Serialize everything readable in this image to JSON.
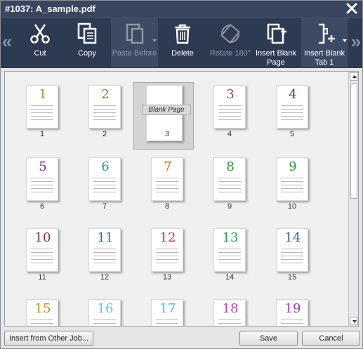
{
  "window": {
    "title": "#1037: A_sample.pdf"
  },
  "toolbar": {
    "cut": "Cut",
    "copy": "Copy",
    "paste_before": "Paste Before",
    "delete": "Delete",
    "rotate": "Rotate 180°",
    "insert_blank_page_1": "Insert Blank",
    "insert_blank_page_2": "Page",
    "insert_blank_tab_1": "Insert Blank",
    "insert_blank_tab_2": "Tab 1"
  },
  "pages": [
    {
      "n": "1",
      "label": "1",
      "color": "#9c8f3e"
    },
    {
      "n": "2",
      "label": "2",
      "color": "#8a7c40"
    },
    {
      "n": "",
      "label": "3",
      "blank": "Blank Page"
    },
    {
      "n": "3",
      "label": "4",
      "color": "#8b3a8f"
    },
    {
      "n": "4",
      "label": "5",
      "color": "#6a2f86"
    },
    {
      "n": "5",
      "label": "6",
      "color": "#6a2f86"
    },
    {
      "n": "6",
      "label": "7",
      "color": "#2f8bb5"
    },
    {
      "n": "7",
      "label": "8",
      "color": "#c2691e"
    },
    {
      "n": "8",
      "label": "9",
      "color": "#2e9a3b"
    },
    {
      "n": "9",
      "label": "10",
      "color": "#2e9a3b"
    },
    {
      "n": "10",
      "label": "11",
      "color": "#8c2e4e"
    },
    {
      "n": "11",
      "label": "12",
      "color": "#2f6fb5"
    },
    {
      "n": "12",
      "label": "13",
      "color": "#b5384e"
    },
    {
      "n": "13",
      "label": "14",
      "color": "#2e9a5b"
    },
    {
      "n": "14",
      "label": "15",
      "color": "#3a5f9c"
    },
    {
      "n": "15",
      "label": "",
      "color": "#c28a1e"
    },
    {
      "n": "16",
      "label": "",
      "color": "#55c8e0"
    },
    {
      "n": "17",
      "label": "",
      "color": "#44c0d0"
    },
    {
      "n": "18",
      "label": "",
      "color": "#b84ab5"
    },
    {
      "n": "19",
      "label": "",
      "color": "#a03ab5"
    }
  ],
  "footer": {
    "insert_other": "Insert from Other Job...",
    "save": "Save",
    "cancel": "Cancel"
  },
  "colors": {
    "titlebar": "#3a4660",
    "toolbar": "#2e3a52",
    "accent_nav": "#8390a8"
  }
}
